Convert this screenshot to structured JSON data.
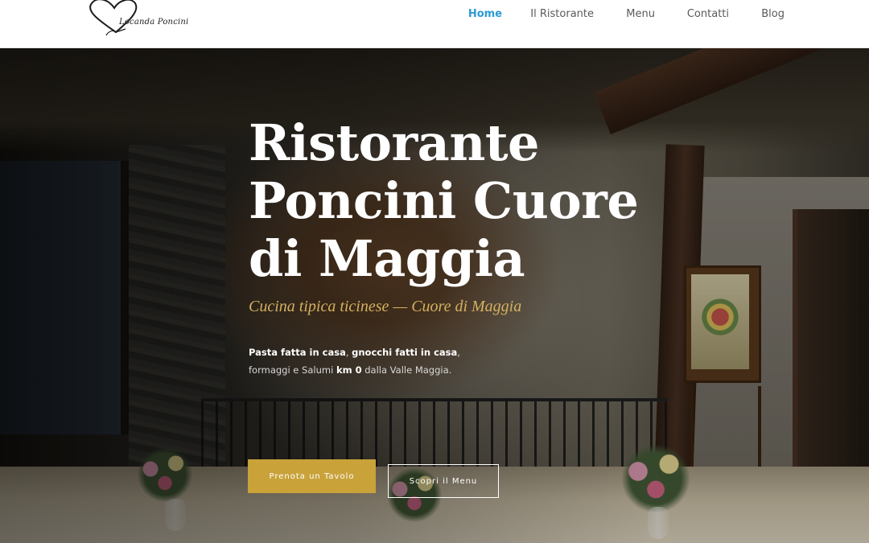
{
  "header": {
    "logo_text": "Locanda Poncini",
    "nav": [
      {
        "label": "Home",
        "active": true
      },
      {
        "label": "Il Ristorante",
        "active": false
      },
      {
        "label": "Menu",
        "active": false
      },
      {
        "label": "Contatti",
        "active": false
      },
      {
        "label": "Blog",
        "active": false
      }
    ]
  },
  "hero": {
    "title_line1": "Ristorante",
    "title_line2": "Poncini Cuore",
    "title_line3": "di Maggia",
    "subtitle": "Cucina tipica ticinese — Cuore di Maggia",
    "desc": {
      "p1_bold": "Pasta fatta in casa",
      "sep1": ", ",
      "p2_bold": "gnocchi fatti in casa",
      "sep2": ",",
      "line2_text": "formaggi e Salumi ",
      "line2_bold": "km 0",
      "line2_tail": " dalla Valle Maggia."
    },
    "primary_button": "Prenota un Tavolo",
    "secondary_button": "Scopri il Menu"
  },
  "colors": {
    "accent_gold": "#c9a23a",
    "nav_active": "#2c9ad6",
    "subtitle": "#d4b160"
  }
}
